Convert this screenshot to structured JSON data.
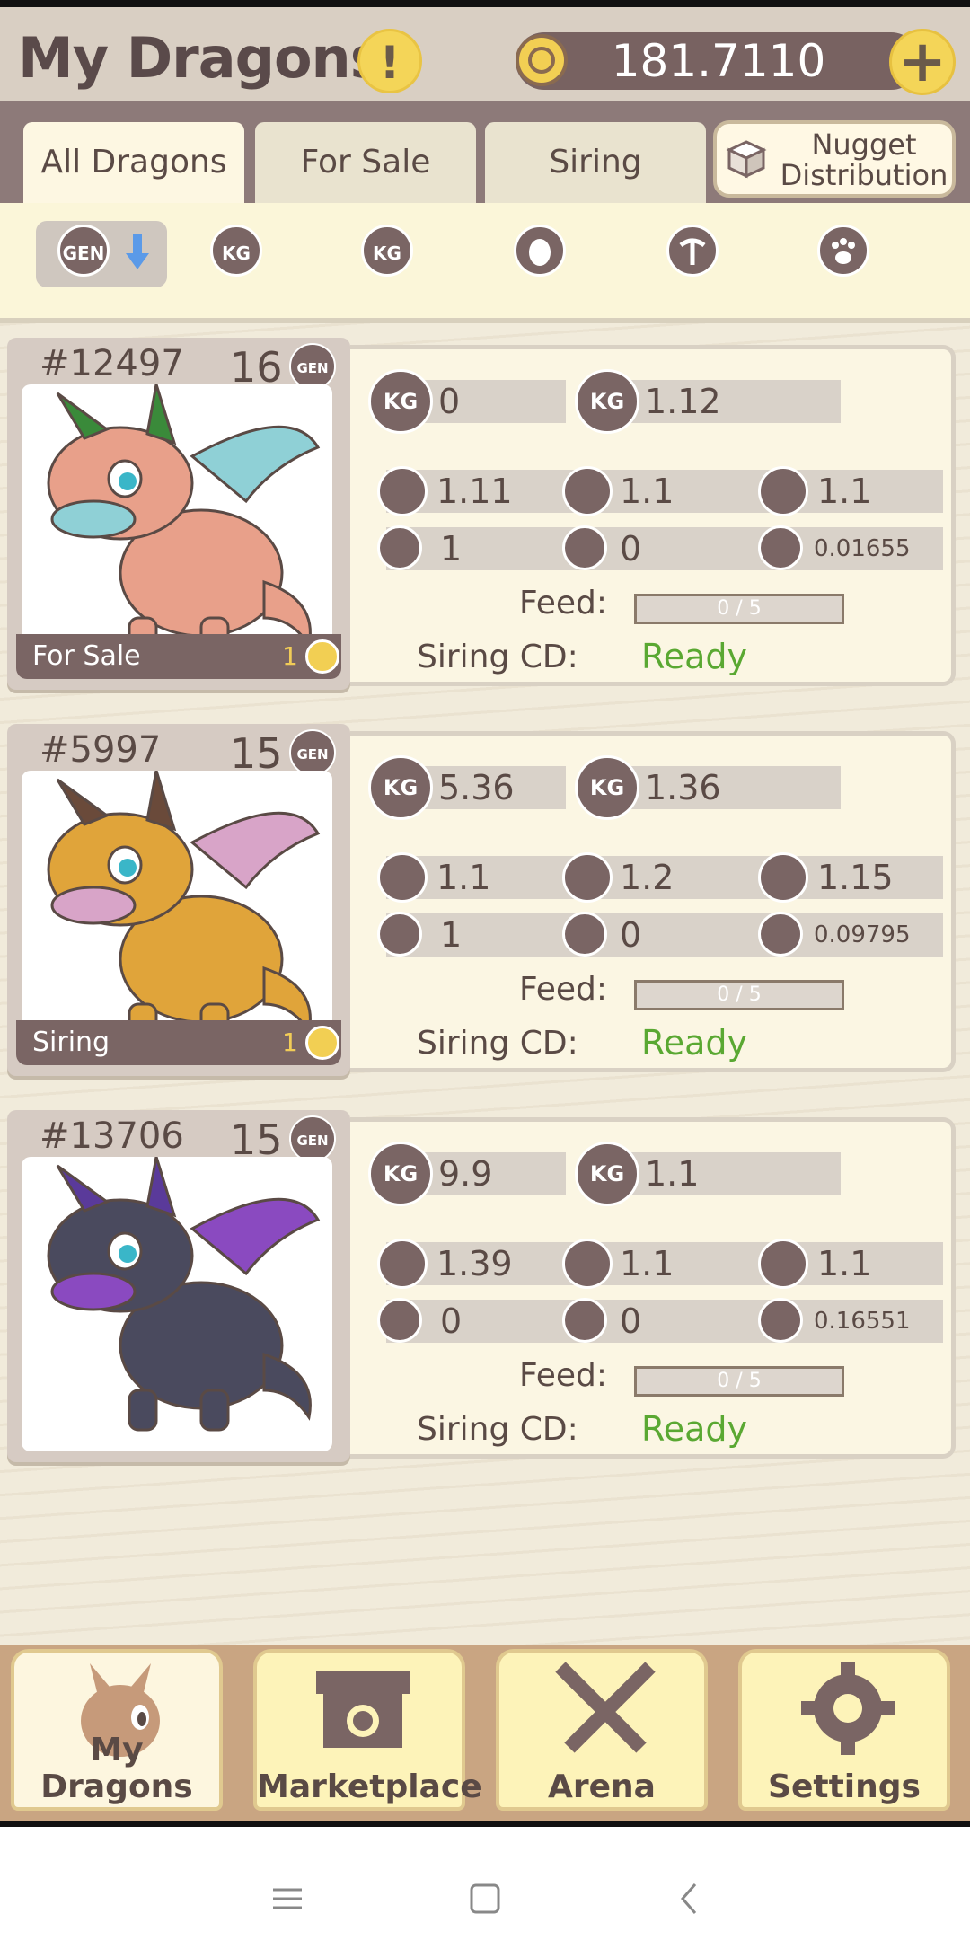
{
  "header": {
    "title": "My Dragons",
    "alert_symbol": "!",
    "balance": "181.7110",
    "add_symbol": "+"
  },
  "tabs": [
    {
      "label": "All Dragons",
      "active": true
    },
    {
      "label": "For Sale",
      "active": false
    },
    {
      "label": "Siring",
      "active": false
    },
    {
      "label": "Nugget Distribution",
      "active": false
    }
  ],
  "filters": {
    "icons": [
      "gen-icon",
      "kg-icon",
      "kg-up-icon",
      "egg-icon",
      "pickaxe-icon",
      "paw-icon"
    ],
    "selected": "gen-icon",
    "sort_direction": "descending"
  },
  "labels": {
    "feed": "Feed:",
    "siring_cd": "Siring CD:",
    "gen_badge": "GEN",
    "kg_badge": "KG"
  },
  "dragons": [
    {
      "id": "#12497",
      "gen": "16",
      "status": "For Sale",
      "status_count": "1",
      "weight": "0",
      "weight_gain": "1.12",
      "egg": "1.11",
      "mine": "1.1",
      "paw": "1.1",
      "hatch": "1",
      "gold": "0",
      "trophy": "0.01655",
      "feed": "0 / 5",
      "feed_progress": 0,
      "siring_cd": "Ready",
      "colors": {
        "body": "#e8a08a",
        "accent": "#8fd0d6",
        "horn": "#3a8a3a"
      }
    },
    {
      "id": "#5997",
      "gen": "15",
      "status": "Siring",
      "status_count": "1",
      "weight": "5.36",
      "weight_gain": "1.36",
      "egg": "1.1",
      "mine": "1.2",
      "paw": "1.15",
      "hatch": "1",
      "gold": "0",
      "trophy": "0.09795",
      "feed": "0 / 5",
      "feed_progress": 0,
      "siring_cd": "Ready",
      "colors": {
        "body": "#e0a43a",
        "accent": "#d8a4c8",
        "horn": "#6a4a3a"
      }
    },
    {
      "id": "#13706",
      "gen": "15",
      "status": "",
      "status_count": "",
      "weight": "9.9",
      "weight_gain": "1.1",
      "egg": "1.39",
      "mine": "1.1",
      "paw": "1.1",
      "hatch": "0",
      "gold": "0",
      "trophy": "0.16551",
      "feed": "0 / 5",
      "feed_progress": 0,
      "siring_cd": "Ready",
      "colors": {
        "body": "#4a4a5e",
        "accent": "#8a4ac0",
        "horn": "#5a3a9a"
      }
    }
  ],
  "bottom_nav": [
    {
      "label": "My Dragons",
      "icon": "dragon-icon",
      "active": true
    },
    {
      "label": "Marketplace",
      "icon": "shop-icon",
      "active": false
    },
    {
      "label": "Arena",
      "icon": "swords-icon",
      "active": false
    },
    {
      "label": "Settings",
      "icon": "gear-icon",
      "active": false
    }
  ],
  "system_nav": [
    "menu-icon",
    "home-icon",
    "back-icon"
  ]
}
